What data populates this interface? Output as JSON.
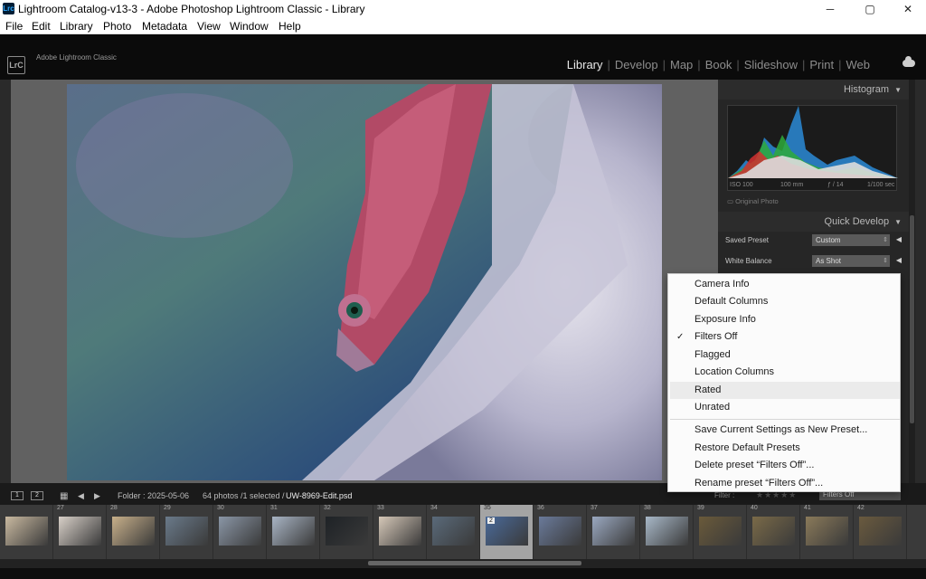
{
  "window": {
    "title": "Lightroom Catalog-v13-3 - Adobe Photoshop Lightroom Classic - Library",
    "app_icon": "Lrc",
    "minimize": "─",
    "maximize": "▢",
    "close": "✕"
  },
  "menubar": [
    "File",
    "Edit",
    "Library",
    "Photo",
    "Metadata",
    "View",
    "Window",
    "Help"
  ],
  "identity": {
    "logo": "LrC",
    "brand": "Adobe Lightroom Classic",
    "modules": [
      "Library",
      "Develop",
      "Map",
      "Book",
      "Slideshow",
      "Print",
      "Web"
    ],
    "active_module": "Library"
  },
  "histogram": {
    "title": "Histogram",
    "iso": "ISO 100",
    "focal": "100 mm",
    "aperture": "ƒ / 14",
    "shutter": "1/100 sec",
    "original_photo": "Original Photo"
  },
  "quick_develop": {
    "title": "Quick Develop",
    "saved_preset_label": "Saved Preset",
    "saved_preset_value": "Custom",
    "white_balance_label": "White Balance",
    "white_balance_value": "As Shot"
  },
  "filmstrip_bar": {
    "view1": "1",
    "view2": "2",
    "folder": "Folder : 2025-05-06",
    "count": "64 photos /1 selected /",
    "filename": "UW-8969-Edit.psd",
    "filter_label": "Filter :",
    "filter_stars": "★★★★★",
    "filter_value": "Filters Off"
  },
  "filmstrip": {
    "numbers": [
      "",
      "27",
      "28",
      "29",
      "30",
      "31",
      "32",
      "33",
      "34",
      "35",
      "36",
      "37",
      "38",
      "39",
      "40",
      "41",
      "42"
    ],
    "selected_index": 9,
    "selected_badge": "2"
  },
  "filter_menu": {
    "items": [
      "Camera Info",
      "Default Columns",
      "Exposure Info",
      "Filters Off",
      "Flagged",
      "Location Columns",
      "Rated",
      "Unrated"
    ],
    "checked": "Filters Off",
    "hovered": "Rated",
    "actions": [
      "Save Current Settings as New Preset...",
      "Restore Default Presets",
      "Delete preset “Filters Off”...",
      "Rename preset “Filters Off”..."
    ]
  }
}
